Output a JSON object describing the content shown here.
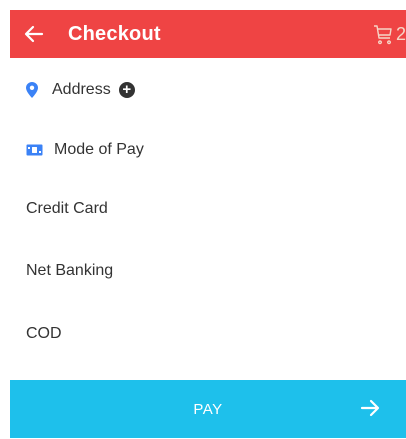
{
  "appbar": {
    "back_icon": "arrow-left-icon",
    "title": "Checkout",
    "cart_icon": "cart-icon",
    "cart_count": "2",
    "color": "#ef4444"
  },
  "address": {
    "icon": "location-pin-icon",
    "label": "Address",
    "add_icon": "plus-circle-icon"
  },
  "mode_of_pay": {
    "icon": "money-icon",
    "label": "Mode of Pay"
  },
  "payment_options": [
    "Credit Card",
    "Net Banking",
    "COD"
  ],
  "pay_button": {
    "label": "PAY",
    "icon": "arrow-right-icon",
    "color": "#1ec0eb"
  }
}
